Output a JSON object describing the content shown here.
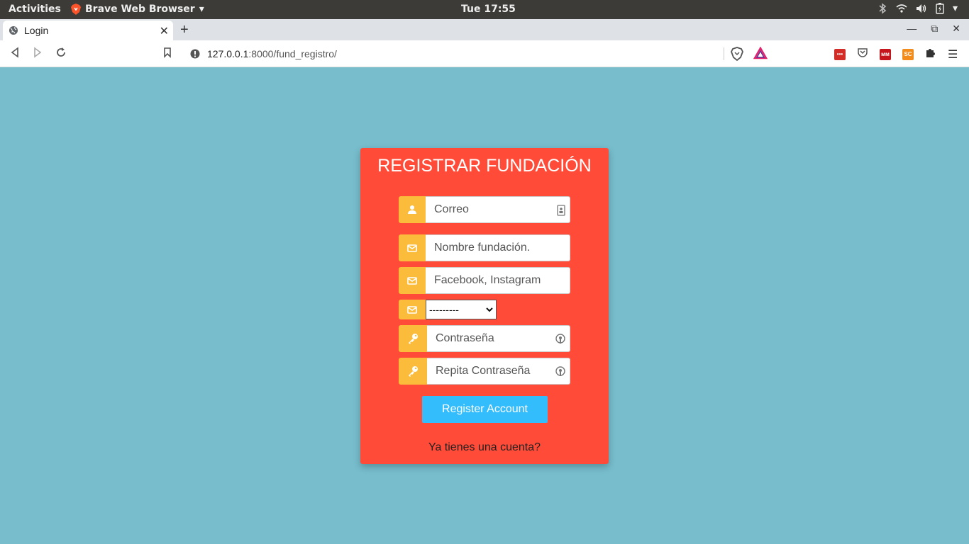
{
  "system": {
    "activities": "Activities",
    "app_name": "Brave Web Browser",
    "clock": "Tue 17:55"
  },
  "browser": {
    "tab_title": "Login",
    "url_host": "127.0.0.1",
    "url_path": ":8000/fund_registro/",
    "extensions": [
      "lastpass-icon",
      "pocket-icon",
      "mendeley-icon",
      "sc-icon",
      "puzzle-icon"
    ]
  },
  "form": {
    "title": "REGISTRAR FUNDACIÓN",
    "email_placeholder": "Correo",
    "name_placeholder": "Nombre fundación.",
    "social_placeholder": "Facebook, Instagram",
    "select_value": "---------",
    "password_placeholder": "Contraseña",
    "repeat_password_placeholder": "Repita Contraseña",
    "submit_label": "Register Account",
    "login_link": "Ya tienes una cuenta?"
  },
  "colors": {
    "page_bg": "#77bdcc",
    "card_bg": "#ff4b38",
    "icon_bg": "#fbbc3c",
    "button_bg": "#33bdfd"
  }
}
